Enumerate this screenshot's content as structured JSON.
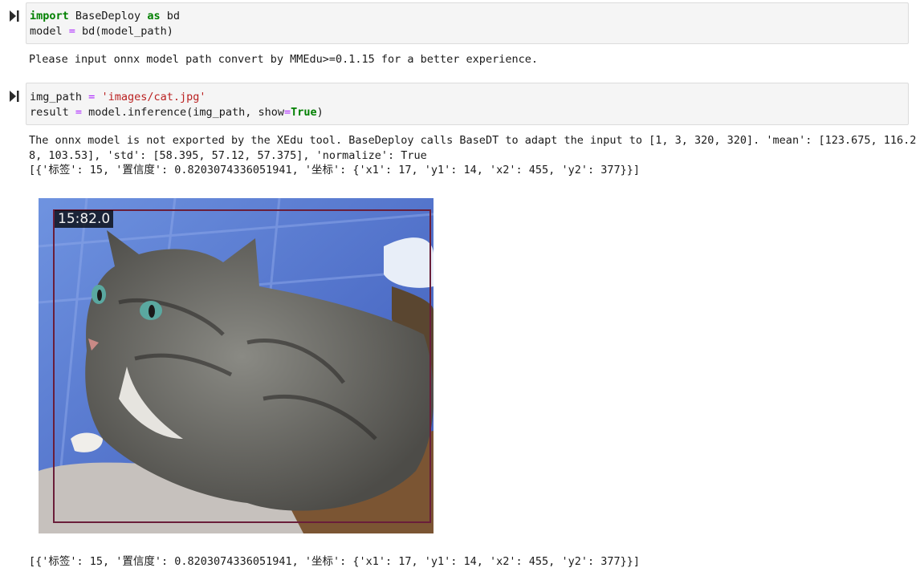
{
  "cells": [
    {
      "code_lines": [
        [
          {
            "t": "import",
            "c": "kw"
          },
          {
            "t": " BaseDeploy "
          },
          {
            "t": "as",
            "c": "kw"
          },
          {
            "t": " bd"
          }
        ],
        [
          {
            "t": "model "
          },
          {
            "t": "=",
            "c": "op"
          },
          {
            "t": " bd(model_path)"
          }
        ]
      ],
      "output": [
        "Please input onnx model path convert by MMEdu>=0.1.15 for a better experience."
      ]
    },
    {
      "code_lines": [
        [
          {
            "t": "img_path "
          },
          {
            "t": "=",
            "c": "op"
          },
          {
            "t": " "
          },
          {
            "t": "'images/cat.jpg'",
            "c": "str"
          }
        ],
        [
          {
            "t": "result "
          },
          {
            "t": "=",
            "c": "op"
          },
          {
            "t": " model.inference(img_path, show"
          },
          {
            "t": "=",
            "c": "op"
          },
          {
            "t": "True",
            "c": "kw"
          },
          {
            "t": ")"
          }
        ]
      ],
      "output": [
        "The onnx model is not exported by the XEdu tool. BaseDeploy calls BaseDT to adapt the input to [1, 3, 320, 320]. 'mean': [123.675, 116.2",
        "8, 103.53], 'std': [58.395, 57.12, 57.375], 'normalize': True",
        "[{'标签': 15, '置信度': 0.8203074336051941, '坐标': {'x1': 17, 'y1': 14, 'x2': 455, 'y2': 377}}]"
      ],
      "figure": {
        "detection_label": "15:82.0",
        "box_color": "#6a1e3a"
      },
      "result_line": "[{'标签': 15, '置信度': 0.8203074336051941, '坐标': {'x1': 17, 'y1': 14, 'x2': 455, 'y2': 377}}]"
    }
  ]
}
